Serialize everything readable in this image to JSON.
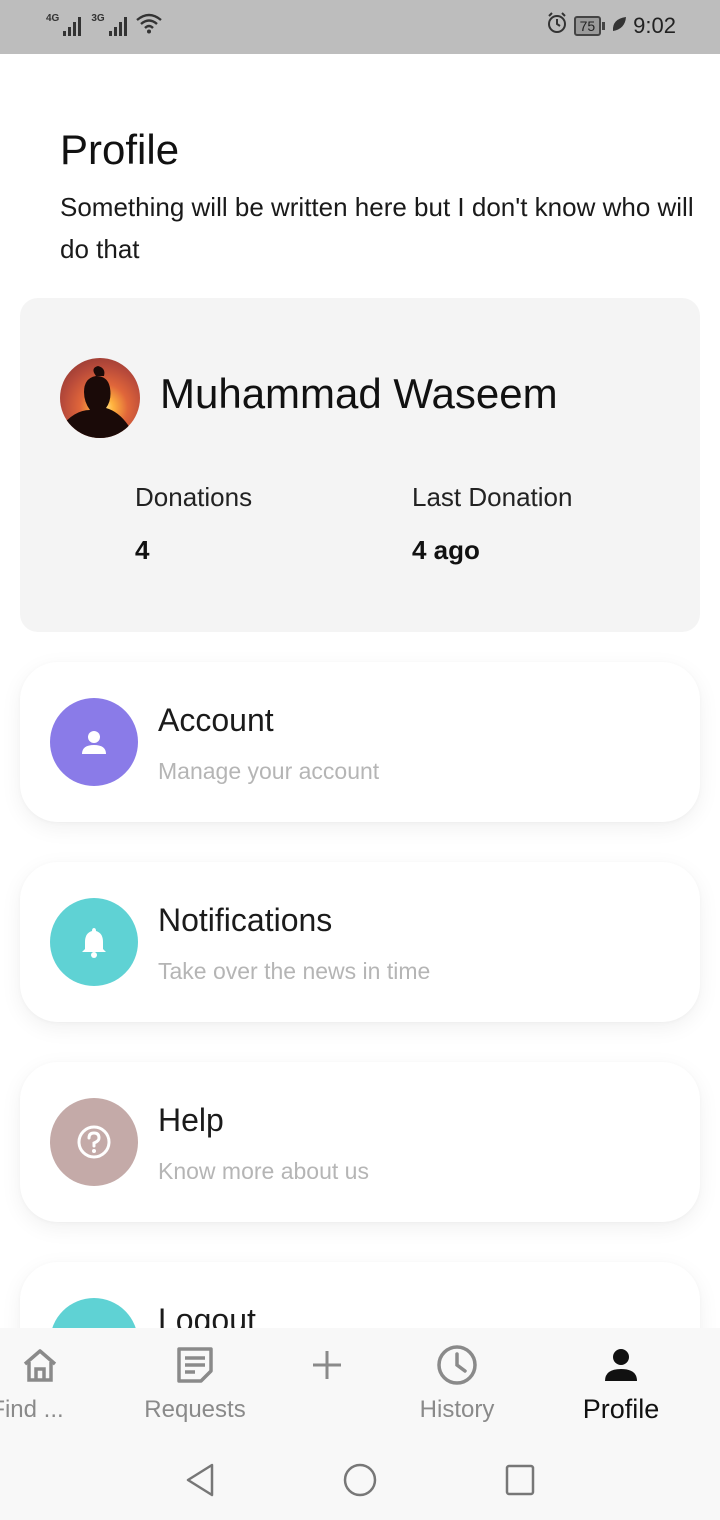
{
  "status_bar": {
    "network_1": "4G",
    "network_2": "3G",
    "battery": "75",
    "time": "9:02"
  },
  "header": {
    "title": "Profile",
    "subtitle": "Something will be written here but I don't know who will do that"
  },
  "profile": {
    "name": "Muhammad Waseem",
    "stats": [
      {
        "label": "Donations",
        "value": "4"
      },
      {
        "label": "Last Donation",
        "value": "4 ago"
      }
    ]
  },
  "menu": [
    {
      "title": "Account",
      "subtitle": "Manage your account",
      "icon": "person-icon",
      "color": "#8a7be8"
    },
    {
      "title": "Notifications",
      "subtitle": "Take over the news in time",
      "icon": "bell-icon",
      "color": "#5fd2d4"
    },
    {
      "title": "Help",
      "subtitle": "Know more about us",
      "icon": "help-icon",
      "color": "#c4aaa8"
    },
    {
      "title": "Logout",
      "subtitle": "",
      "icon": "logout-icon",
      "color": "#5fd2d4"
    }
  ],
  "bottom_nav": [
    {
      "label": "Find ...",
      "icon": "home-icon",
      "active": false
    },
    {
      "label": "Requests",
      "icon": "requests-icon",
      "active": false
    },
    {
      "label": "",
      "icon": "plus-icon",
      "active": false
    },
    {
      "label": "History",
      "icon": "history-icon",
      "active": false
    },
    {
      "label": "Profile",
      "icon": "profile-icon",
      "active": true
    }
  ],
  "system_nav": [
    "back-icon",
    "home-circle-icon",
    "recents-icon"
  ]
}
